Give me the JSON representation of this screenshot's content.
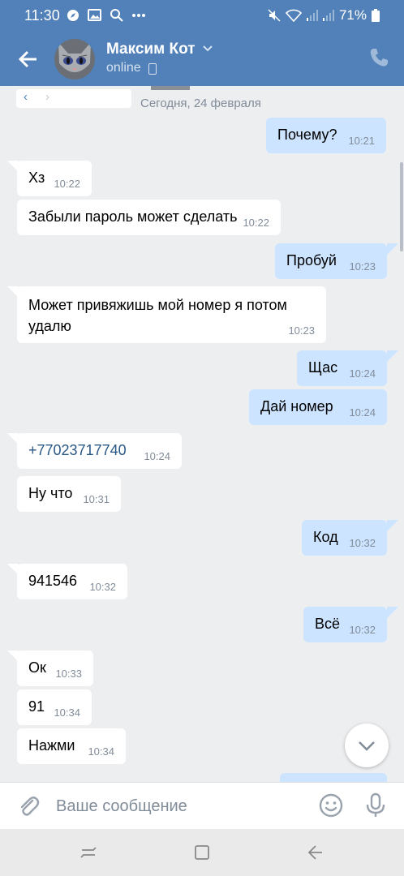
{
  "status_bar": {
    "time": "11:30",
    "battery": "71%",
    "icons_left": [
      "compass-icon",
      "gallery-icon",
      "search-icon",
      "more-icon"
    ],
    "icons_right": [
      "mute-icon",
      "wifi-icon",
      "signal-icon",
      "signal-icon",
      "battery-icon"
    ]
  },
  "header": {
    "name": "Максим Кот",
    "status": "online",
    "accent": "#5181b8"
  },
  "date_separator": "Сегодня, 24 февраля",
  "messages": [
    {
      "dir": "out",
      "text": "Почему?",
      "time": "10:21"
    },
    {
      "dir": "in",
      "text": "Хз",
      "time": "10:22"
    },
    {
      "dir": "in",
      "text": "Забыли пароль может сделать",
      "time": "10:22"
    },
    {
      "dir": "out",
      "text": "Пробуй",
      "time": "10:23"
    },
    {
      "dir": "in",
      "text": "Может привяжишь мой номер я потом удалю",
      "time": "10:23"
    },
    {
      "dir": "out",
      "text": "Щас",
      "time": "10:24"
    },
    {
      "dir": "out",
      "text": "Дай номер",
      "time": "10:24"
    },
    {
      "dir": "in",
      "text": "+77023717740",
      "time": "10:24",
      "link": true
    },
    {
      "dir": "in",
      "text": "Ну что",
      "time": "10:31"
    },
    {
      "dir": "out",
      "text": "Код",
      "time": "10:32"
    },
    {
      "dir": "in",
      "text": "941546",
      "time": "10:32"
    },
    {
      "dir": "out",
      "text": "Всё",
      "time": "10:32"
    },
    {
      "dir": "in",
      "text": "Ок",
      "time": "10:33"
    },
    {
      "dir": "in",
      "text": "91",
      "time": "10:34"
    },
    {
      "dir": "in",
      "text": "Нажми",
      "time": "10:34"
    }
  ],
  "input": {
    "placeholder": "Ваше сообщение"
  },
  "colors": {
    "incoming_bubble": "#ffffff",
    "outgoing_bubble": "#cce4ff",
    "chat_background": "#edeef0",
    "link": "#2a5885"
  }
}
